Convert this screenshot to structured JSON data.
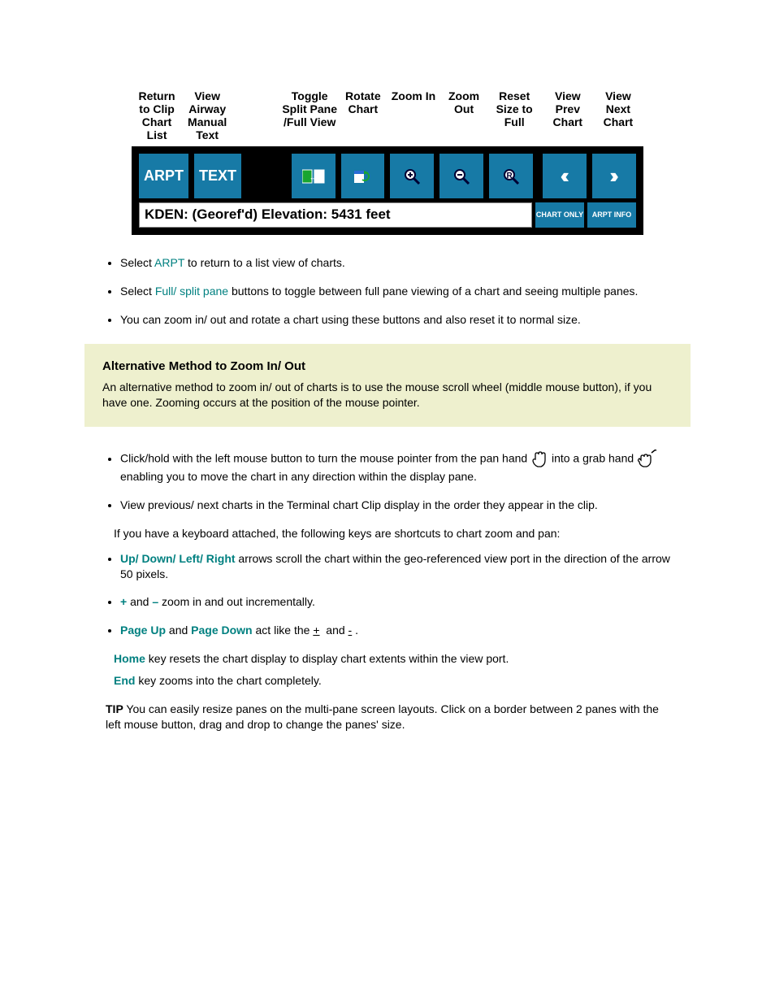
{
  "toolbar_labels": {
    "arpt": "Return to Clip Chart List",
    "text": "View Airway Manual Text",
    "split": "Toggle Split Pane /Full View",
    "rotate": "Rotate Chart",
    "zin": "Zoom In",
    "zout": "Zoom Out",
    "reset": "Reset Size to Full",
    "prev": "View Prev Chart",
    "next": "View Next Chart"
  },
  "toolbar_buttons": {
    "arpt": "ARPT",
    "text": "TEXT",
    "prev": "‹‹",
    "next": "››"
  },
  "info_bar": "KDEN: (Georef'd)   Elevation: 5431 feet",
  "small_buttons": {
    "chart_only": "CHART ONLY",
    "arpt_info": "ARPT INFO"
  },
  "bullets_top": {
    "l1_pre": "Select ",
    "l1_key": "ARPT",
    "l1_post": " to return to a list view of charts.",
    "l2_pre": "Select ",
    "l2_key": "Full/ split pane",
    "l2_post": " buttons to toggle between full pane viewing of a chart and seeing multiple panes.",
    "l3_pre": "You can zoom in/ out and rotate a chart using these buttons and also reset it to normal size."
  },
  "callout": {
    "title": "Alternative Method to Zoom In/ Out",
    "body": "An alternative method to zoom in/ out of charts is to use the mouse scroll wheel (middle mouse button), if you have one. Zooming occurs at the position of the mouse pointer."
  },
  "bullets_mid": {
    "pan_pre": "Click/hold with the left mouse button to turn the mouse pointer from the pan hand ",
    "pan_mid": " into a grab hand ",
    "pan_post": " enabling you to move the chart in any direction within the display pane.",
    "prevnext": "View previous/ next charts in the Terminal chart Clip display in the order they appear in the clip."
  },
  "keys": {
    "intro": "If you have a keyboard attached, the following keys are shortcuts to chart zoom and pan:",
    "rows": [
      "Up/ Down/ Left/ Right arrows scroll the chart within the geo-referenced view port in the direction of the arrow 50 pixels.",
      "+ and – zoom in and out incrementally.",
      "Page Up and Page Down act like the +  and - .",
      "Home key resets the chart display to display chart extents within the view port.",
      "End key zooms into the chart completely."
    ]
  },
  "tip": {
    "label": "TIP",
    "body": "You can easily resize panes on the multi-pane screen layouts. Click on a border between 2 panes with the left mouse button, drag and drop to change the panes' size."
  }
}
